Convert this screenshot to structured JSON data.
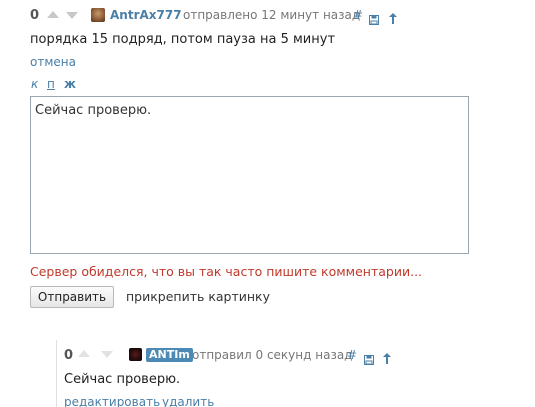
{
  "comment1": {
    "rating": "0",
    "author": "AntrAx777",
    "meta": "отправлено 12 минут назад",
    "actions": {
      "anchor": "#",
      "save_icon": "save-icon",
      "up_icon": "arrow-up-icon"
    },
    "text": "порядка 15 подряд, потом пауза на 5 минут",
    "cancel_label": "отмена"
  },
  "format_toolbar": {
    "italic": "к",
    "underline": "п",
    "bold": "ж"
  },
  "editor": {
    "value": "Сейчас проверю."
  },
  "error_message": "Сервер обиделся, что вы так часто пишите комментарии...",
  "submit_label": "Отправить",
  "attach_label": "прикрепить картинку",
  "comment2": {
    "rating": "0",
    "author": "ANTIm",
    "meta": "отправил 0 секунд назад",
    "actions": {
      "anchor": "#",
      "save_icon": "save-icon",
      "up_icon": "arrow-up-icon"
    },
    "text": "Сейчас проверю.",
    "edit_label": "редактировать",
    "delete_label": "удалить"
  },
  "colors": {
    "link": "#4a7fa8",
    "error": "#c0392b",
    "badge": "#4a8ab5"
  }
}
